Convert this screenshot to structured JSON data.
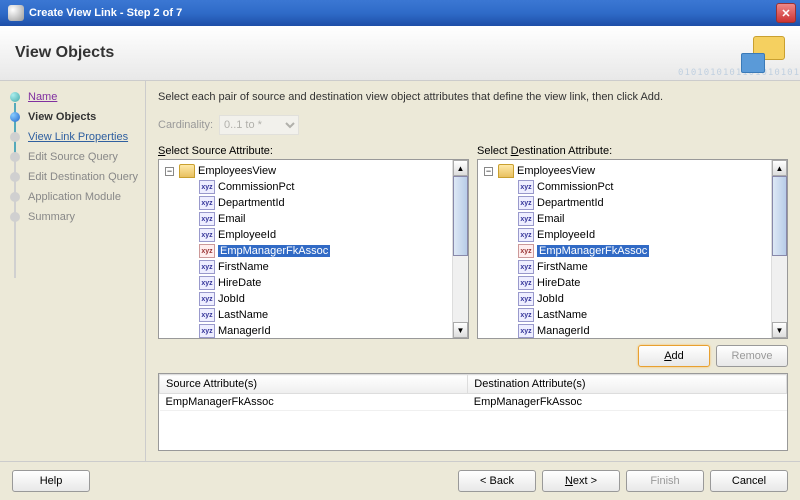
{
  "window": {
    "title": "Create View Link - Step 2 of 7"
  },
  "header": {
    "title": "View Objects",
    "bg_digits": "0101010101101010101"
  },
  "sidebar": {
    "steps": [
      {
        "label": "Name",
        "state": "completed link purple"
      },
      {
        "label": "View Objects",
        "state": "current"
      },
      {
        "label": "View Link Properties",
        "state": "link"
      },
      {
        "label": "Edit Source Query",
        "state": ""
      },
      {
        "label": "Edit Destination Query",
        "state": ""
      },
      {
        "label": "Application Module",
        "state": ""
      },
      {
        "label": "Summary",
        "state": ""
      }
    ]
  },
  "content": {
    "instruction": "Select each pair of source and destination view object attributes that define the view link, then click Add.",
    "cardinality_label": "Cardinality:",
    "cardinality_value": "0..1 to *",
    "source_label": "Select Source Attribute:",
    "dest_label": "Select Destination Attribute:",
    "tree_root": "EmployeesView",
    "attributes": [
      {
        "name": "CommissionPct",
        "fk": false
      },
      {
        "name": "DepartmentId",
        "fk": false
      },
      {
        "name": "Email",
        "fk": false
      },
      {
        "name": "EmployeeId",
        "fk": false
      },
      {
        "name": "EmpManagerFkAssoc",
        "fk": true,
        "selected": true
      },
      {
        "name": "FirstName",
        "fk": false
      },
      {
        "name": "HireDate",
        "fk": false
      },
      {
        "name": "JobId",
        "fk": false
      },
      {
        "name": "LastName",
        "fk": false
      },
      {
        "name": "ManagerId",
        "fk": false
      }
    ],
    "add_label": "Add",
    "remove_label": "Remove",
    "table": {
      "col_source": "Source Attribute(s)",
      "col_dest": "Destination Attribute(s)",
      "rows": [
        {
          "source": "EmpManagerFkAssoc",
          "dest": "EmpManagerFkAssoc"
        }
      ]
    }
  },
  "footer": {
    "help": "Help",
    "back": "< Back",
    "next": "Next >",
    "finish": "Finish",
    "cancel": "Cancel"
  }
}
